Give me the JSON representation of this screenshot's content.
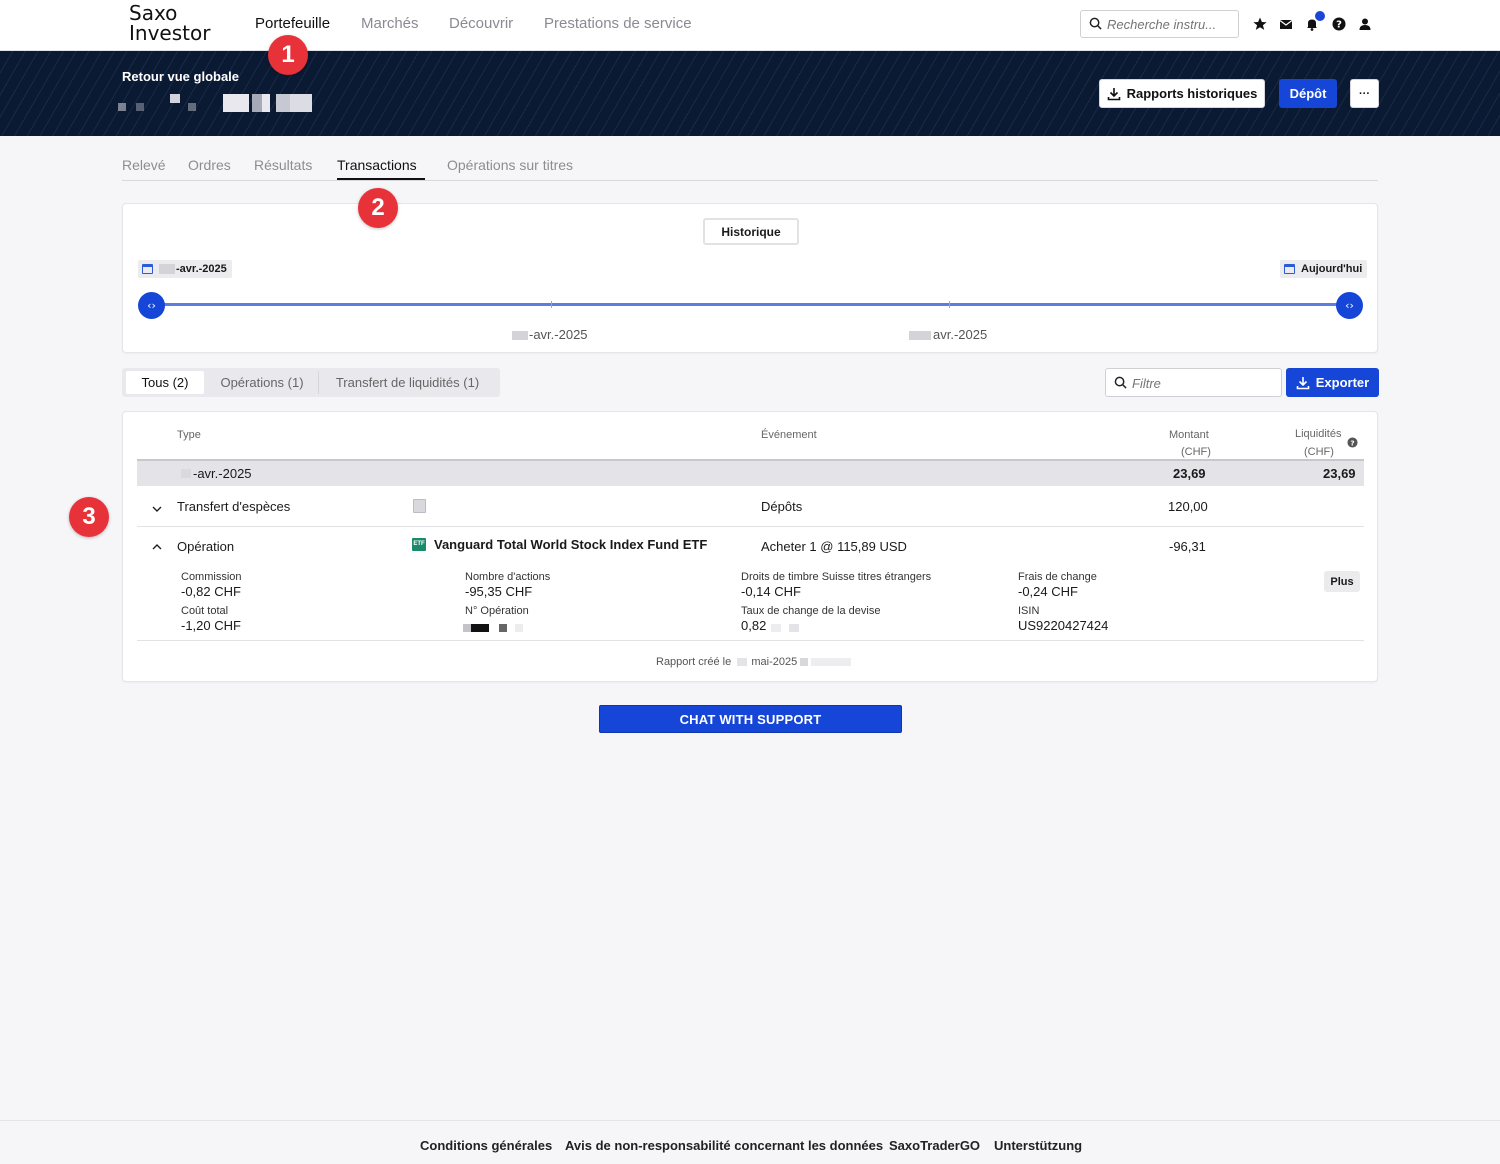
{
  "app": {
    "logo_line1": "Saxo",
    "logo_line2": "Investor"
  },
  "topnav": {
    "items": [
      "Portefeuille",
      "Marchés",
      "Découvrir",
      "Prestations de service"
    ],
    "active": "Portefeuille",
    "search_placeholder": "Recherche instru..."
  },
  "annotations": [
    "1",
    "2",
    "3"
  ],
  "header": {
    "back_label": "Retour vue globale",
    "reports_button": "Rapports historiques",
    "deposit_button": "Dépôt",
    "more_button": "···"
  },
  "subtabs": {
    "items": [
      "Relevé",
      "Ordres",
      "Résultats",
      "Transactions",
      "Opérations sur titres"
    ],
    "active": "Transactions"
  },
  "timeline": {
    "mode_button": "Historique",
    "start_chip": "-avr.-2025",
    "end_chip": "Aujourd'hui",
    "tick_labels": [
      "-avr.-2025",
      "avr.-2025"
    ]
  },
  "filters": {
    "segments": [
      "Tous (2)",
      "Opérations (1)",
      "Transfert de liquidités (1)"
    ],
    "active": "Tous (2)",
    "filter_placeholder": "Filtre",
    "export_button": "Exporter"
  },
  "table": {
    "headers": {
      "type": "Type",
      "event": "Événement",
      "amount": "Montant",
      "amount_unit": "(CHF)",
      "liquidity": "Liquidités",
      "liquidity_unit": "(CHF)"
    },
    "group": {
      "date": "-avr.-2025",
      "amount": "23,69",
      "liquidity": "23,69"
    },
    "rows": [
      {
        "type": "Transfert d'espèces",
        "instrument": "",
        "event": "Dépôts",
        "amount": "120,00"
      },
      {
        "type": "Opération",
        "instrument_tag": "ETF",
        "instrument": "Vanguard Total World Stock Index Fund ETF",
        "event": "Acheter 1 @ 115,89 USD",
        "amount": "-96,31"
      }
    ],
    "details": {
      "commission_label": "Commission",
      "commission_value": "-0,82 CHF",
      "shares_label": "Nombre d'actions",
      "shares_value": "-95,35 CHF",
      "stamp_label": "Droits de timbre Suisse titres étrangers",
      "stamp_value": "-0,14 CHF",
      "fx_fee_label": "Frais de change",
      "fx_fee_value": "-0,24 CHF",
      "total_label": "Coût total",
      "total_value": "-1,20 CHF",
      "op_no_label": "N° Opération",
      "fx_rate_label": "Taux de change de la devise",
      "fx_rate_value": "0,82",
      "isin_label": "ISIN",
      "isin_value": "US9220427424",
      "more_button": "Plus"
    },
    "report_created": "Rapport créé le",
    "report_date": "mai-2025"
  },
  "chat_button": "CHAT WITH SUPPORT",
  "footer": {
    "links": [
      "Conditions générales",
      "Avis de non-responsabilité concernant les données",
      "SaxoTraderGO",
      "Unterstützung"
    ]
  },
  "colors": {
    "brand_blue": "#1546d8",
    "header_navy": "#0b1a33",
    "badge_red": "#e8323a"
  }
}
